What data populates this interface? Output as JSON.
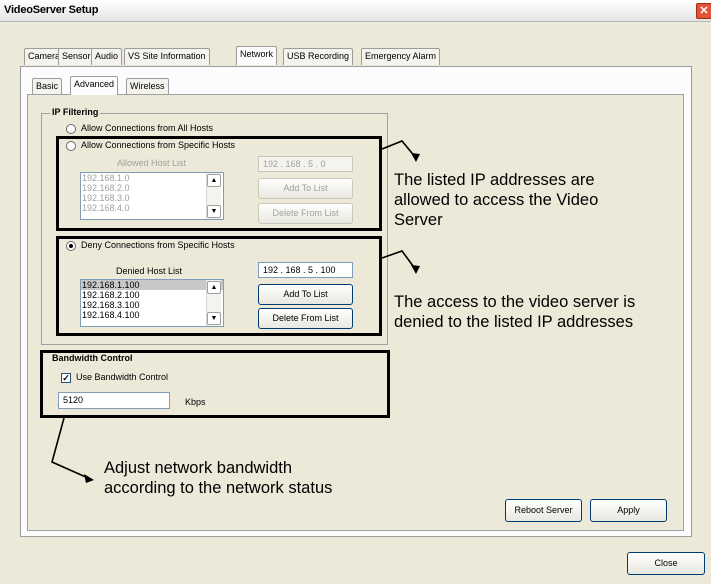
{
  "window": {
    "title": "VideoServer Setup",
    "close_glyph": "✕"
  },
  "main_tabs": [
    {
      "label": "Camera",
      "active": false
    },
    {
      "label": "Sensor",
      "active": false
    },
    {
      "label": "Audio",
      "active": false
    },
    {
      "label": "VS Site Information",
      "active": false
    },
    {
      "label": "Network",
      "active": true
    },
    {
      "label": "USB Recording",
      "active": false
    },
    {
      "label": "Emergency Alarm",
      "active": false
    }
  ],
  "sub_tabs": [
    {
      "label": "Basic",
      "active": false
    },
    {
      "label": "Advanced",
      "active": true
    },
    {
      "label": "Wireless",
      "active": false
    }
  ],
  "ip_filtering": {
    "title": "IP Filtering",
    "allow_all_label": "Allow Connections from All Hosts",
    "allow_specific_label": "Allow Connections from Specific Hosts",
    "deny_specific_label": "Deny Connections from Specific Hosts",
    "selected_option": "deny_specific",
    "allowed": {
      "list_title": "Allowed Host List",
      "ip_input": "192 . 168 .  5  .  0",
      "hosts": [
        "192.168.1.0",
        "192.168.2.0",
        "192.168.3.0",
        "192.168.4.0"
      ],
      "add_label": "Add To List",
      "delete_label": "Delete From List"
    },
    "denied": {
      "list_title": "Denied Host List",
      "ip_input": "192 . 168 .  5  . 100",
      "hosts": [
        "192.168.1.100",
        "192.168.2.100",
        "192.168.3.100",
        "192.168.4.100"
      ],
      "selected_index": 0,
      "add_label": "Add To List",
      "delete_label": "Delete From List"
    }
  },
  "bandwidth": {
    "title": "Bandwidth Control",
    "use_label": "Use Bandwidth Control",
    "checked": true,
    "value": "5120",
    "unit": "Kbps"
  },
  "footer": {
    "reboot_label": "Reboot Server",
    "apply_label": "Apply",
    "close_label": "Close"
  },
  "annotations": {
    "allowed_note": [
      "The listed IP addresses are",
      "allowed to access the Video",
      "Server"
    ],
    "denied_note": [
      "The access to the video server is",
      "denied to the listed IP addresses"
    ],
    "bandwidth_note": [
      "Adjust network bandwidth",
      "according to the network status"
    ]
  }
}
